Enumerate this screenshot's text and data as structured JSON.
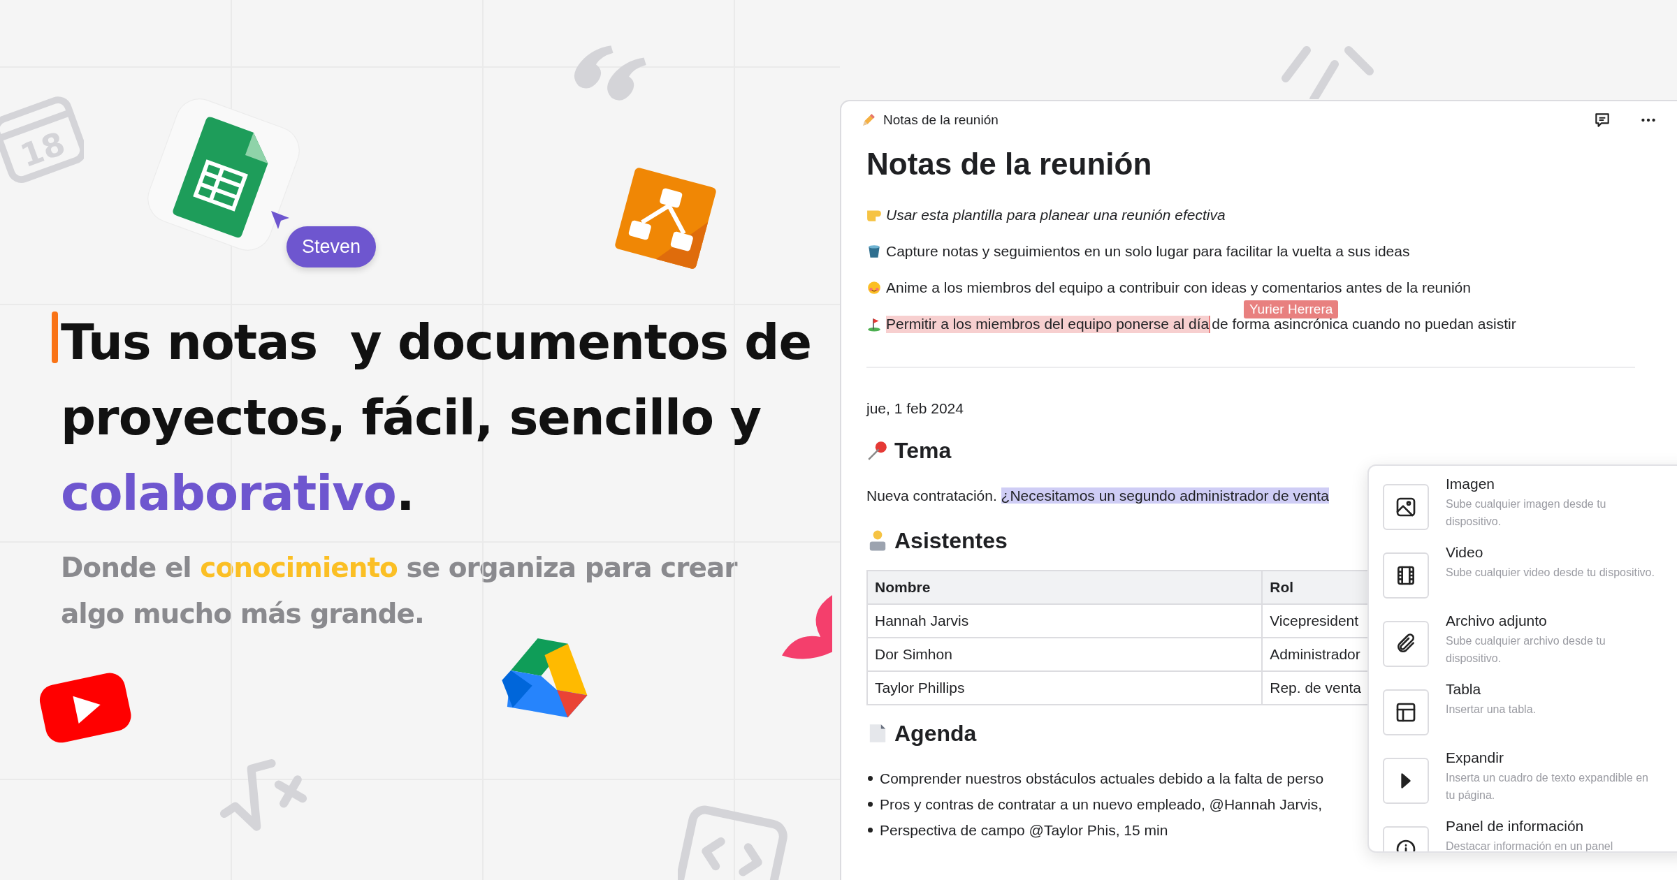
{
  "hero": {
    "collaborator": {
      "name": "Steven",
      "color": "#6e56cf"
    },
    "calendar_day": "18",
    "headline": [
      [
        {
          "text": "Tus notas  y documentos de",
          "kind": "plain"
        }
      ],
      [
        {
          "text": "proyectos, fácil, sencillo y",
          "kind": "plain"
        }
      ],
      [
        {
          "text": "colaborativo",
          "kind": "accent"
        },
        {
          "text": ".",
          "kind": "plain"
        }
      ]
    ],
    "subtitle": [
      {
        "text": "Donde el ",
        "kind": "plain"
      },
      {
        "text": "conocimiento",
        "kind": "accent"
      },
      {
        "text": " se organiza para crear algo mucho más grande.",
        "kind": "plain"
      }
    ]
  },
  "editor": {
    "breadcrumb": "Notas de la reunión",
    "title": "Notas de la reunión",
    "intro": [
      {
        "italic": true,
        "parts": [
          {
            "text": "Usar esta plantilla para planear una reunión efectiva",
            "kind": "plain"
          }
        ]
      },
      {
        "italic": false,
        "parts": [
          {
            "text": "Capture notas y seguimientos en un solo lugar para facilitar la vuelta a sus ideas",
            "kind": "plain"
          }
        ]
      },
      {
        "italic": false,
        "parts": [
          {
            "text": "Anime a los miembros del equipo a contribuir con ideas y comentarios antes de la reunión",
            "kind": "plain"
          }
        ]
      },
      {
        "italic": false,
        "parts": [
          {
            "text": "Permitir a los miembros del equipo ponerse al día",
            "kind": "collab"
          },
          {
            "text": "de forma asincrónica cuando no puedan asistir",
            "kind": "plain"
          }
        ],
        "cursor": {
          "name": "Yurier Herrera",
          "color": "#e8807f"
        }
      }
    ],
    "date": "jue, 1 feb 2024",
    "sections": [
      {
        "heading": "Tema",
        "kind": "paragraph",
        "parts": [
          {
            "text": "Nueva contratación. ",
            "kind": "plain"
          },
          {
            "text": "¿Necesitamos un segundo administrador de venta",
            "kind": "selection"
          }
        ]
      },
      {
        "heading": "Asistentes",
        "kind": "table",
        "table": {
          "columns": [
            "Nombre",
            "Rol"
          ],
          "rows": [
            [
              "Hannah Jarvis",
              "Vicepresident"
            ],
            [
              "Dor Simhon",
              "Administrador"
            ],
            [
              "Taylor Phillips",
              "Rep. de venta"
            ]
          ]
        }
      },
      {
        "heading": "Agenda",
        "kind": "bullets",
        "items": [
          "Comprender nuestros obstáculos actuales debido a la falta de perso",
          "Pros y contras de contratar a un nuevo empleado, @Hannah Jarvis,",
          "Perspectiva de campo @Taylor Phis, 15 min"
        ]
      }
    ],
    "insert_menu": [
      {
        "title": "Imagen",
        "description": "Sube cualquier imagen desde tu dispositivo."
      },
      {
        "title": "Video",
        "description": "Sube cualquier video desde tu dispositivo."
      },
      {
        "title": "Archivo adjunto",
        "description": "Sube cualquier archivo desde tu dispositivo."
      },
      {
        "title": "Tabla",
        "description": "Insertar una tabla."
      },
      {
        "title": "Expandir",
        "description": "Inserta un cuadro de texto expandible en tu página."
      },
      {
        "title": "Panel de información",
        "description": "Destacar información en un panel"
      }
    ]
  }
}
